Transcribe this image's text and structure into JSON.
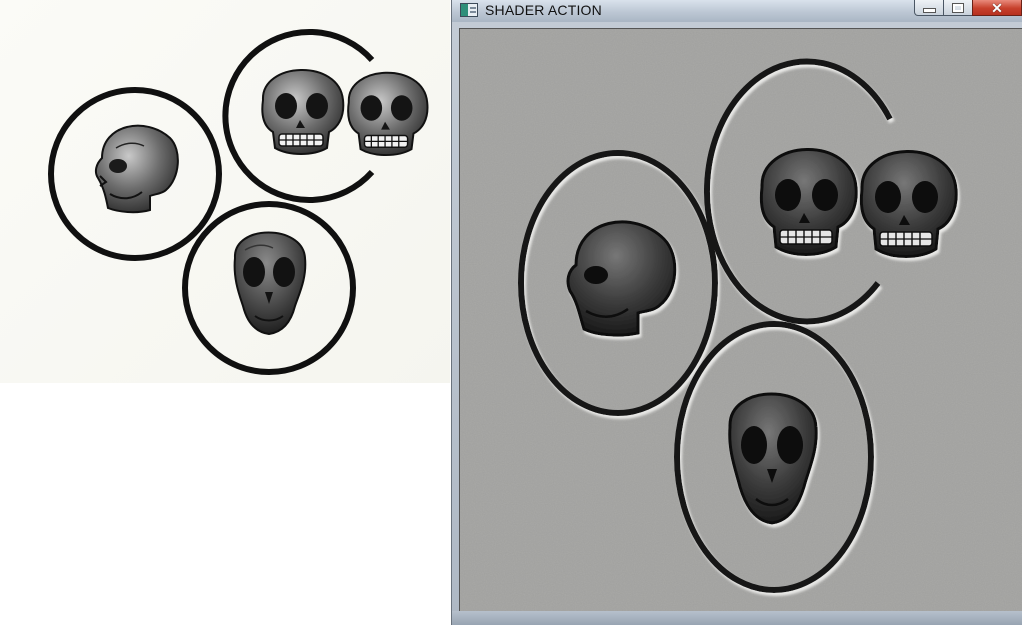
{
  "window": {
    "title": "SHADER ACTION",
    "icon": "app-window-icon",
    "controls": {
      "minimize": "minimize-icon",
      "maximize": "maximize-icon",
      "close": "close-icon",
      "close_glyph": "✕"
    }
  },
  "reference_image": {
    "background": "#f8f8f3",
    "ink": "#111111"
  },
  "render": {
    "background": "#a8a8a6",
    "ink": "#1a1a1a"
  },
  "icons": [
    "skull-icon",
    "ring-icon"
  ]
}
